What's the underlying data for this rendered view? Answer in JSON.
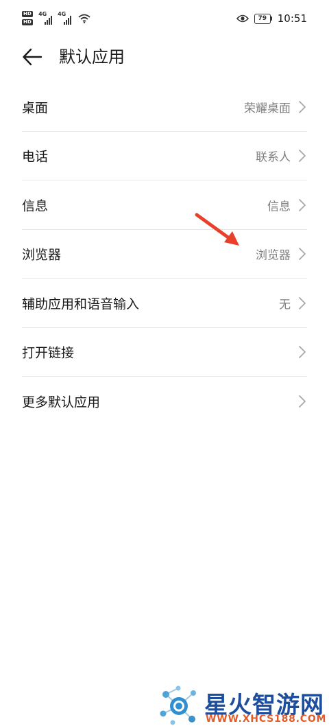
{
  "status_bar": {
    "sim1_badge": "HD",
    "sim2_badge": "HD",
    "sim1_network": "4G",
    "sim2_network": "4G",
    "battery_level": "79",
    "time": "10:51",
    "icons": [
      "signal-icon",
      "wifi-icon",
      "eye-icon",
      "battery-icon"
    ]
  },
  "header": {
    "back_icon": "back-arrow-icon",
    "title": "默认应用"
  },
  "settings": {
    "items": [
      {
        "label": "桌面",
        "value": "荣耀桌面"
      },
      {
        "label": "电话",
        "value": "联系人"
      },
      {
        "label": "信息",
        "value": "信息"
      },
      {
        "label": "浏览器",
        "value": "浏览器"
      },
      {
        "label": "辅助应用和语音输入",
        "value": "无"
      },
      {
        "label": "打开链接",
        "value": ""
      },
      {
        "label": "更多默认应用",
        "value": ""
      }
    ]
  },
  "annotation": {
    "arrow_color": "#e8402a"
  },
  "watermark": {
    "name": "星火智游网",
    "url": "WWW.XHCS188.COM"
  },
  "colors": {
    "background": "#ffffff",
    "text_primary": "#1a1a1a",
    "text_secondary": "#808080",
    "divider": "#e6e6e6"
  }
}
